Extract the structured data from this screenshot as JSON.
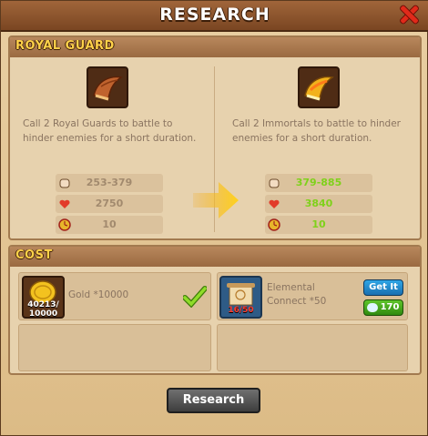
{
  "window": {
    "title": "RESEARCH"
  },
  "sections": {
    "upgrade_title": "ROYAL GUARD",
    "cost_title": "COST"
  },
  "current": {
    "icon": "brown-horn-icon",
    "description": "Call 2 Royal Guards to battle to hinder enemies for a short duration.",
    "stats": {
      "damage": "253-379",
      "health": "2750",
      "duration": "10"
    }
  },
  "upgraded": {
    "icon": "golden-horn-icon",
    "description": "Call 2 Immortals to battle to hinder enemies for a short duration.",
    "stats": {
      "damage": "379-885",
      "health": "3840",
      "duration": "10"
    }
  },
  "cost": {
    "gold": {
      "label": "Gold *10000",
      "have": "40213/",
      "need": "10000",
      "satisfied": true,
      "icon": "gold-coin-icon"
    },
    "scroll": {
      "label_line1": "Elemental",
      "label_line2": "Connect *50",
      "progress": "16/50",
      "icon": "scroll-icon",
      "get_button": "Get It",
      "gem_price": "170"
    }
  },
  "actions": {
    "research_button": "Research"
  },
  "colors": {
    "upgraded_stat": "#7fd11b",
    "base_stat": "#a28a6e",
    "accent_gold": "#ffd24a"
  }
}
